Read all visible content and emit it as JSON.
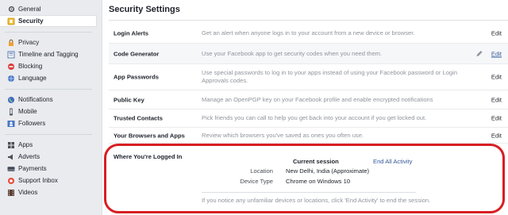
{
  "sidebar": {
    "groups": [
      [
        {
          "label": "General",
          "icon": "gear-icon"
        },
        {
          "label": "Security",
          "icon": "security-shield-icon",
          "active": true
        }
      ],
      [
        {
          "label": "Privacy",
          "icon": "privacy-lock-icon"
        },
        {
          "label": "Timeline and Tagging",
          "icon": "timeline-icon"
        },
        {
          "label": "Blocking",
          "icon": "blocking-icon"
        },
        {
          "label": "Language",
          "icon": "language-globe-icon"
        }
      ],
      [
        {
          "label": "Notifications",
          "icon": "globe-icon"
        },
        {
          "label": "Mobile",
          "icon": "mobile-icon"
        },
        {
          "label": "Followers",
          "icon": "followers-icon"
        }
      ],
      [
        {
          "label": "Apps",
          "icon": "apps-icon"
        },
        {
          "label": "Adverts",
          "icon": "adverts-icon"
        },
        {
          "label": "Payments",
          "icon": "payments-icon"
        },
        {
          "label": "Support Inbox",
          "icon": "support-icon"
        },
        {
          "label": "Videos",
          "icon": "videos-icon"
        }
      ]
    ]
  },
  "main": {
    "title": "Security Settings",
    "rows": [
      {
        "label": "Login Alerts",
        "desc": "Get an alert when anyone logs in to your account from a new device or browser.",
        "edit": "Edit"
      },
      {
        "label": "Code Generator",
        "desc": "Use your Facebook app to get security codes when you need them.",
        "edit": "Edit",
        "hover": true
      },
      {
        "label": "App Passwords",
        "desc": "Use special passwords to log in to your apps instead of using your Facebook password or Login Approvals codes.",
        "edit": "Edit"
      },
      {
        "label": "Public Key",
        "desc": "Manage an OpenPGP key on your Facebook profile and enable encrypted notifications",
        "edit": "Edit"
      },
      {
        "label": "Trusted Contacts",
        "desc": "Pick friends you can call to help you get back into your account if you get locked out.",
        "edit": "Edit"
      },
      {
        "label": "Your Browsers and Apps",
        "desc": "Review which browsers you've saved as ones you often use.",
        "edit": "Edit"
      }
    ],
    "logged_in": {
      "label": "Where You're Logged In",
      "session_heading": "Current session",
      "end_all": "End All Activity",
      "location_key": "Location",
      "location_value": "New Delhi, India (Approximate)",
      "device_key": "Device Type",
      "device_value": "Chrome on Windows 10",
      "notice": "If you notice any unfamiliar devices or locations, click 'End Activity' to end the session."
    }
  },
  "colors": {
    "link": "#365899",
    "highlight": "#d81e22"
  }
}
